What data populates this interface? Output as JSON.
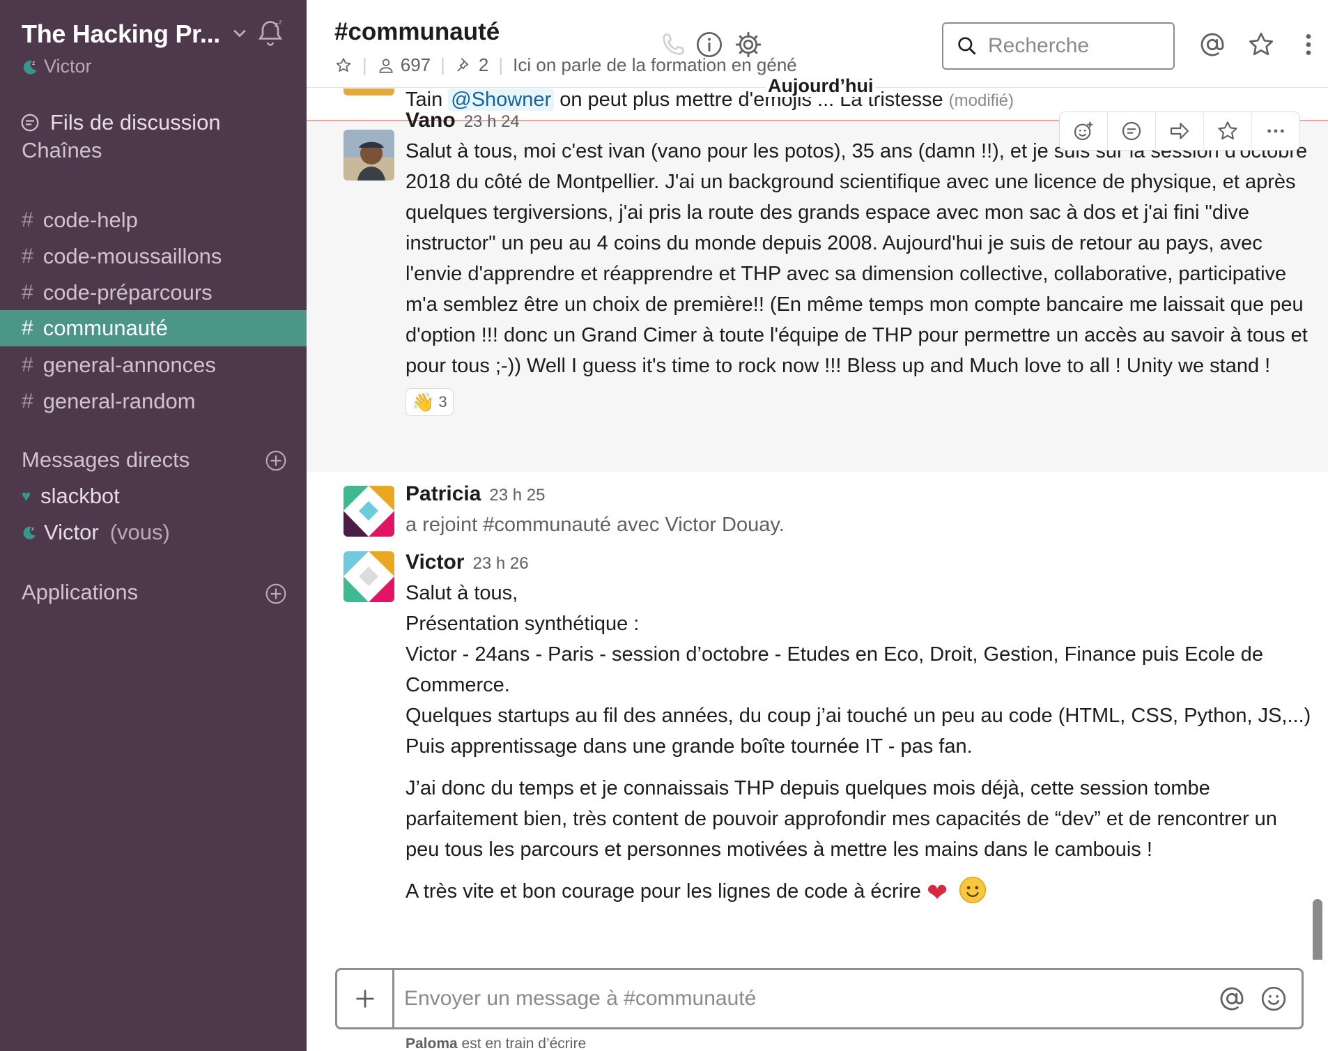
{
  "workspace": {
    "name": "The Hacking Pr...",
    "user": "Victor"
  },
  "sidebar": {
    "threads_label": "Fils de discussion",
    "channels_title": "Chaînes",
    "channels": [
      {
        "name": "code-help",
        "active": false
      },
      {
        "name": "code-moussaillons",
        "active": false
      },
      {
        "name": "code-préparcours",
        "active": false
      },
      {
        "name": "communauté",
        "active": true
      },
      {
        "name": "general-annonces",
        "active": false
      },
      {
        "name": "general-random",
        "active": false
      }
    ],
    "dm_title": "Messages directs",
    "dms": [
      {
        "name": "slackbot",
        "suffix": ""
      },
      {
        "name": "Victor",
        "suffix": "(vous)"
      }
    ],
    "apps_title": "Applications"
  },
  "header": {
    "channel": "#communauté",
    "members": "697",
    "pins": "2",
    "topic": "Ici on parle de la formation en géné",
    "search_placeholder": "Recherche"
  },
  "messages": {
    "today_label": "Aujourd’hui",
    "prev": {
      "pre": "Tain",
      "mention": "@Showner",
      "post": "on peut plus mettre d'emojis ... La tristesse",
      "edited": "(modifié)"
    },
    "vano": {
      "author": "Vano",
      "time": "23 h 24",
      "text": "Salut à tous, moi c'est ivan (vano pour les potos), 35 ans (damn !!), et je suis sur la session d'octobre 2018 du côté de Montpellier. J'ai un background scientifique avec une licence de physique, et après quelques tergiversions,  j'ai pris la route des grands espace avec mon sac à dos et j'ai fini \"dive instructor\" un peu au 4 coins du monde depuis 2008. Aujourd'hui je suis de retour au pays, avec l'envie d'apprendre et réapprendre et THP avec sa dimension collective, collaborative, participative m'a semblez être un choix de première!! (En même temps mon compte bancaire me laissait que peu d'option !!! donc un Grand Cimer à toute l'équipe de THP pour permettre un accès au savoir à tous et pour tous  ;-)) Well I guess it's time to rock now !!!   Bless up and Much love to all ! Unity we stand !",
      "reaction_emoji": "👋",
      "reaction_count": "3"
    },
    "patricia": {
      "author": "Patricia",
      "time": "23 h 25",
      "text": "a rejoint #communauté avec Victor Douay."
    },
    "victor": {
      "author": "Victor",
      "time": "23 h 26",
      "lines": [
        "Salut à tous,",
        "Présentation synthétique :",
        "Victor - 24ans -  Paris - session d’octobre - Etudes en Eco, Droit, Gestion, Finance puis Ecole de Commerce.",
        "Quelques startups au fil des années, du coup j’ai touché un peu au code (HTML, CSS, Python, JS,...)",
        "Puis apprentissage dans une grande boîte tournée IT - pas fan."
      ],
      "para2": "J’ai donc du temps et je connaissais THP depuis quelques mois déjà, cette session tombe parfaitement bien, très content de pouvoir approfondir mes capacités de “dev” et de rencontrer un peu tous les parcours et personnes motivées à mettre les mains dans le cambouis !",
      "para3": "A très vite et bon courage pour les lignes de code à écrire",
      "para3_emoji": "❤"
    }
  },
  "composer": {
    "placeholder": "Envoyer un message à #communauté"
  },
  "typing": {
    "name": "Paloma",
    "text": "est en train d’écrire"
  },
  "colors": {
    "sidebar_bg": "#4d394b",
    "active_channel": "#4c9689",
    "mention_bg": "#e8f5fa",
    "mention_text": "#1264a3"
  },
  "icons": {
    "header": [
      "star-icon",
      "member-icon",
      "pin-icon",
      "phone-icon",
      "info-icon",
      "gear-icon",
      "search-icon",
      "mention-icon",
      "star-icon",
      "more-vertical-icon"
    ],
    "message_actions": [
      "add-reaction-icon",
      "start-thread-icon",
      "share-icon",
      "save-icon",
      "more-horizontal-icon"
    ]
  }
}
